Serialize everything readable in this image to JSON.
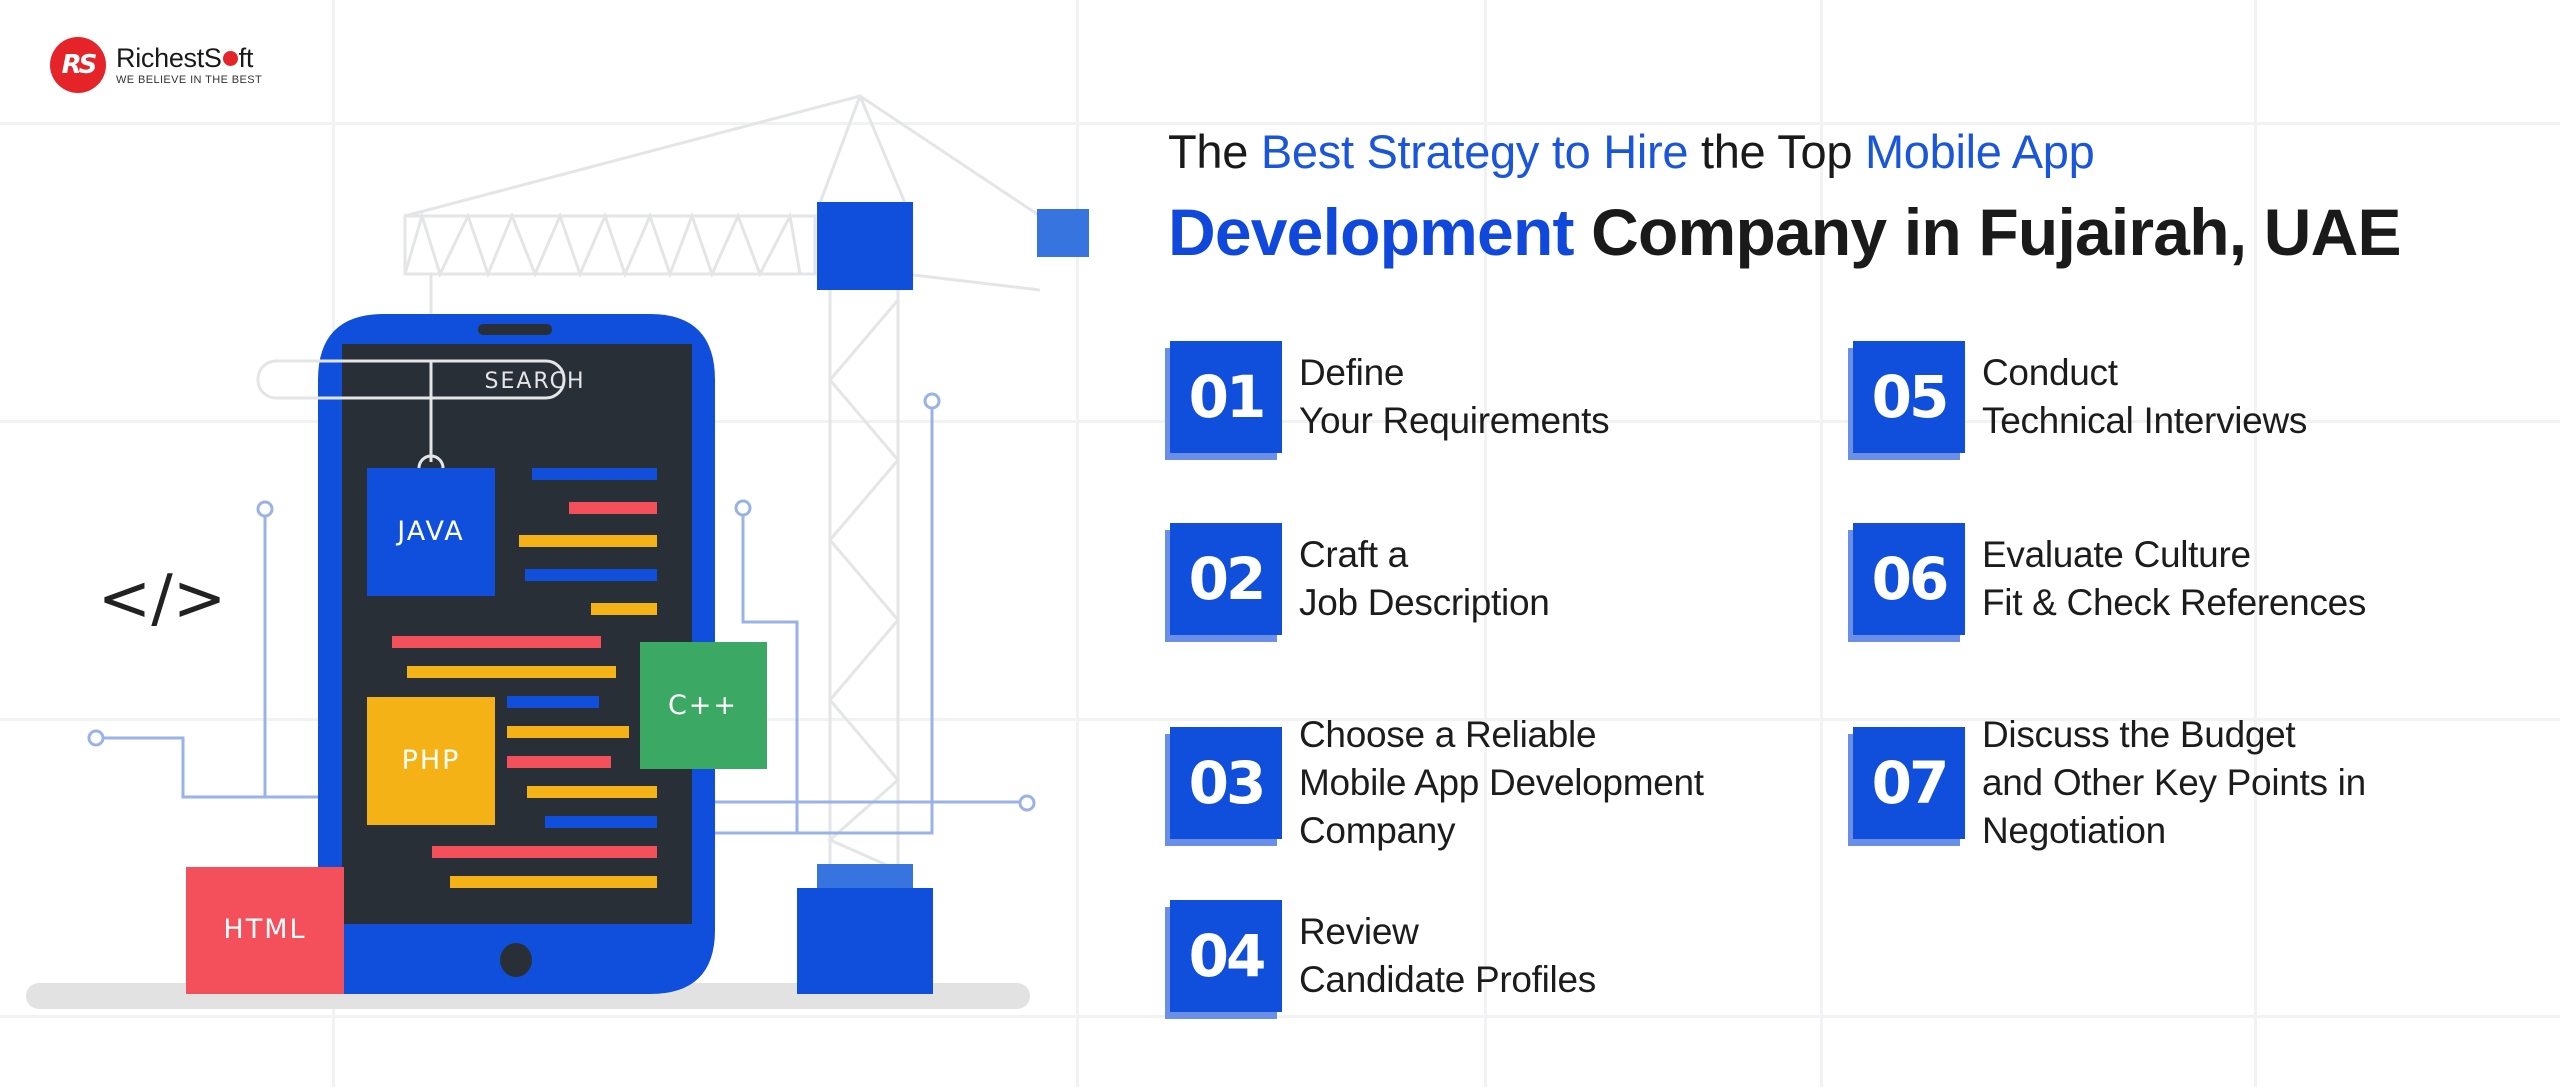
{
  "brand": {
    "name_prefix": "RichestS",
    "name_suffix": "ft",
    "tagline": "WE BELIEVE IN THE BEST",
    "mark": "RS",
    "colors": {
      "red": "#e5242a",
      "blue": "#104fdc",
      "dark": "#1a1a1a"
    }
  },
  "title": {
    "line1": [
      {
        "text": "The ",
        "accent": false
      },
      {
        "text": "Best Strategy to Hire",
        "accent": true
      },
      {
        "text": " the Top ",
        "accent": false
      },
      {
        "text": "Mobile App",
        "accent": true
      }
    ],
    "line2": [
      {
        "text": "Development",
        "accent": true
      },
      {
        "text": " Company in Fujairah, UAE",
        "accent": false
      }
    ]
  },
  "steps": [
    {
      "number": "01",
      "lines": [
        "Define",
        "Your Requirements"
      ]
    },
    {
      "number": "02",
      "lines": [
        "Craft a",
        "Job Description"
      ]
    },
    {
      "number": "03",
      "lines": [
        "Choose a Reliable",
        "Mobile App Development",
        "Company"
      ]
    },
    {
      "number": "04",
      "lines": [
        "Review",
        "Candidate Profiles"
      ]
    },
    {
      "number": "05",
      "lines": [
        "Conduct",
        "Technical Interviews"
      ]
    },
    {
      "number": "06",
      "lines": [
        "Evaluate Culture",
        "Fit & Check References"
      ]
    },
    {
      "number": "07",
      "lines": [
        "Discuss the Budget",
        "and Other Key Points in",
        "Negotiation"
      ]
    }
  ],
  "illustration": {
    "search_label": "SEARCH",
    "code_icon": "</>",
    "blocks": {
      "java": "JAVA",
      "php": "PHP",
      "cpp": "C++",
      "html": "HTML"
    },
    "colors": {
      "phone": "#104fdc",
      "screen": "#282f37",
      "java": "#104fdc",
      "php": "#f4b216",
      "cpp": "#3ba964",
      "html": "#f4505b",
      "crane_line": "#e4e5e7",
      "wire": "#9ab3e6",
      "shelf": "#e2e2e2"
    }
  }
}
